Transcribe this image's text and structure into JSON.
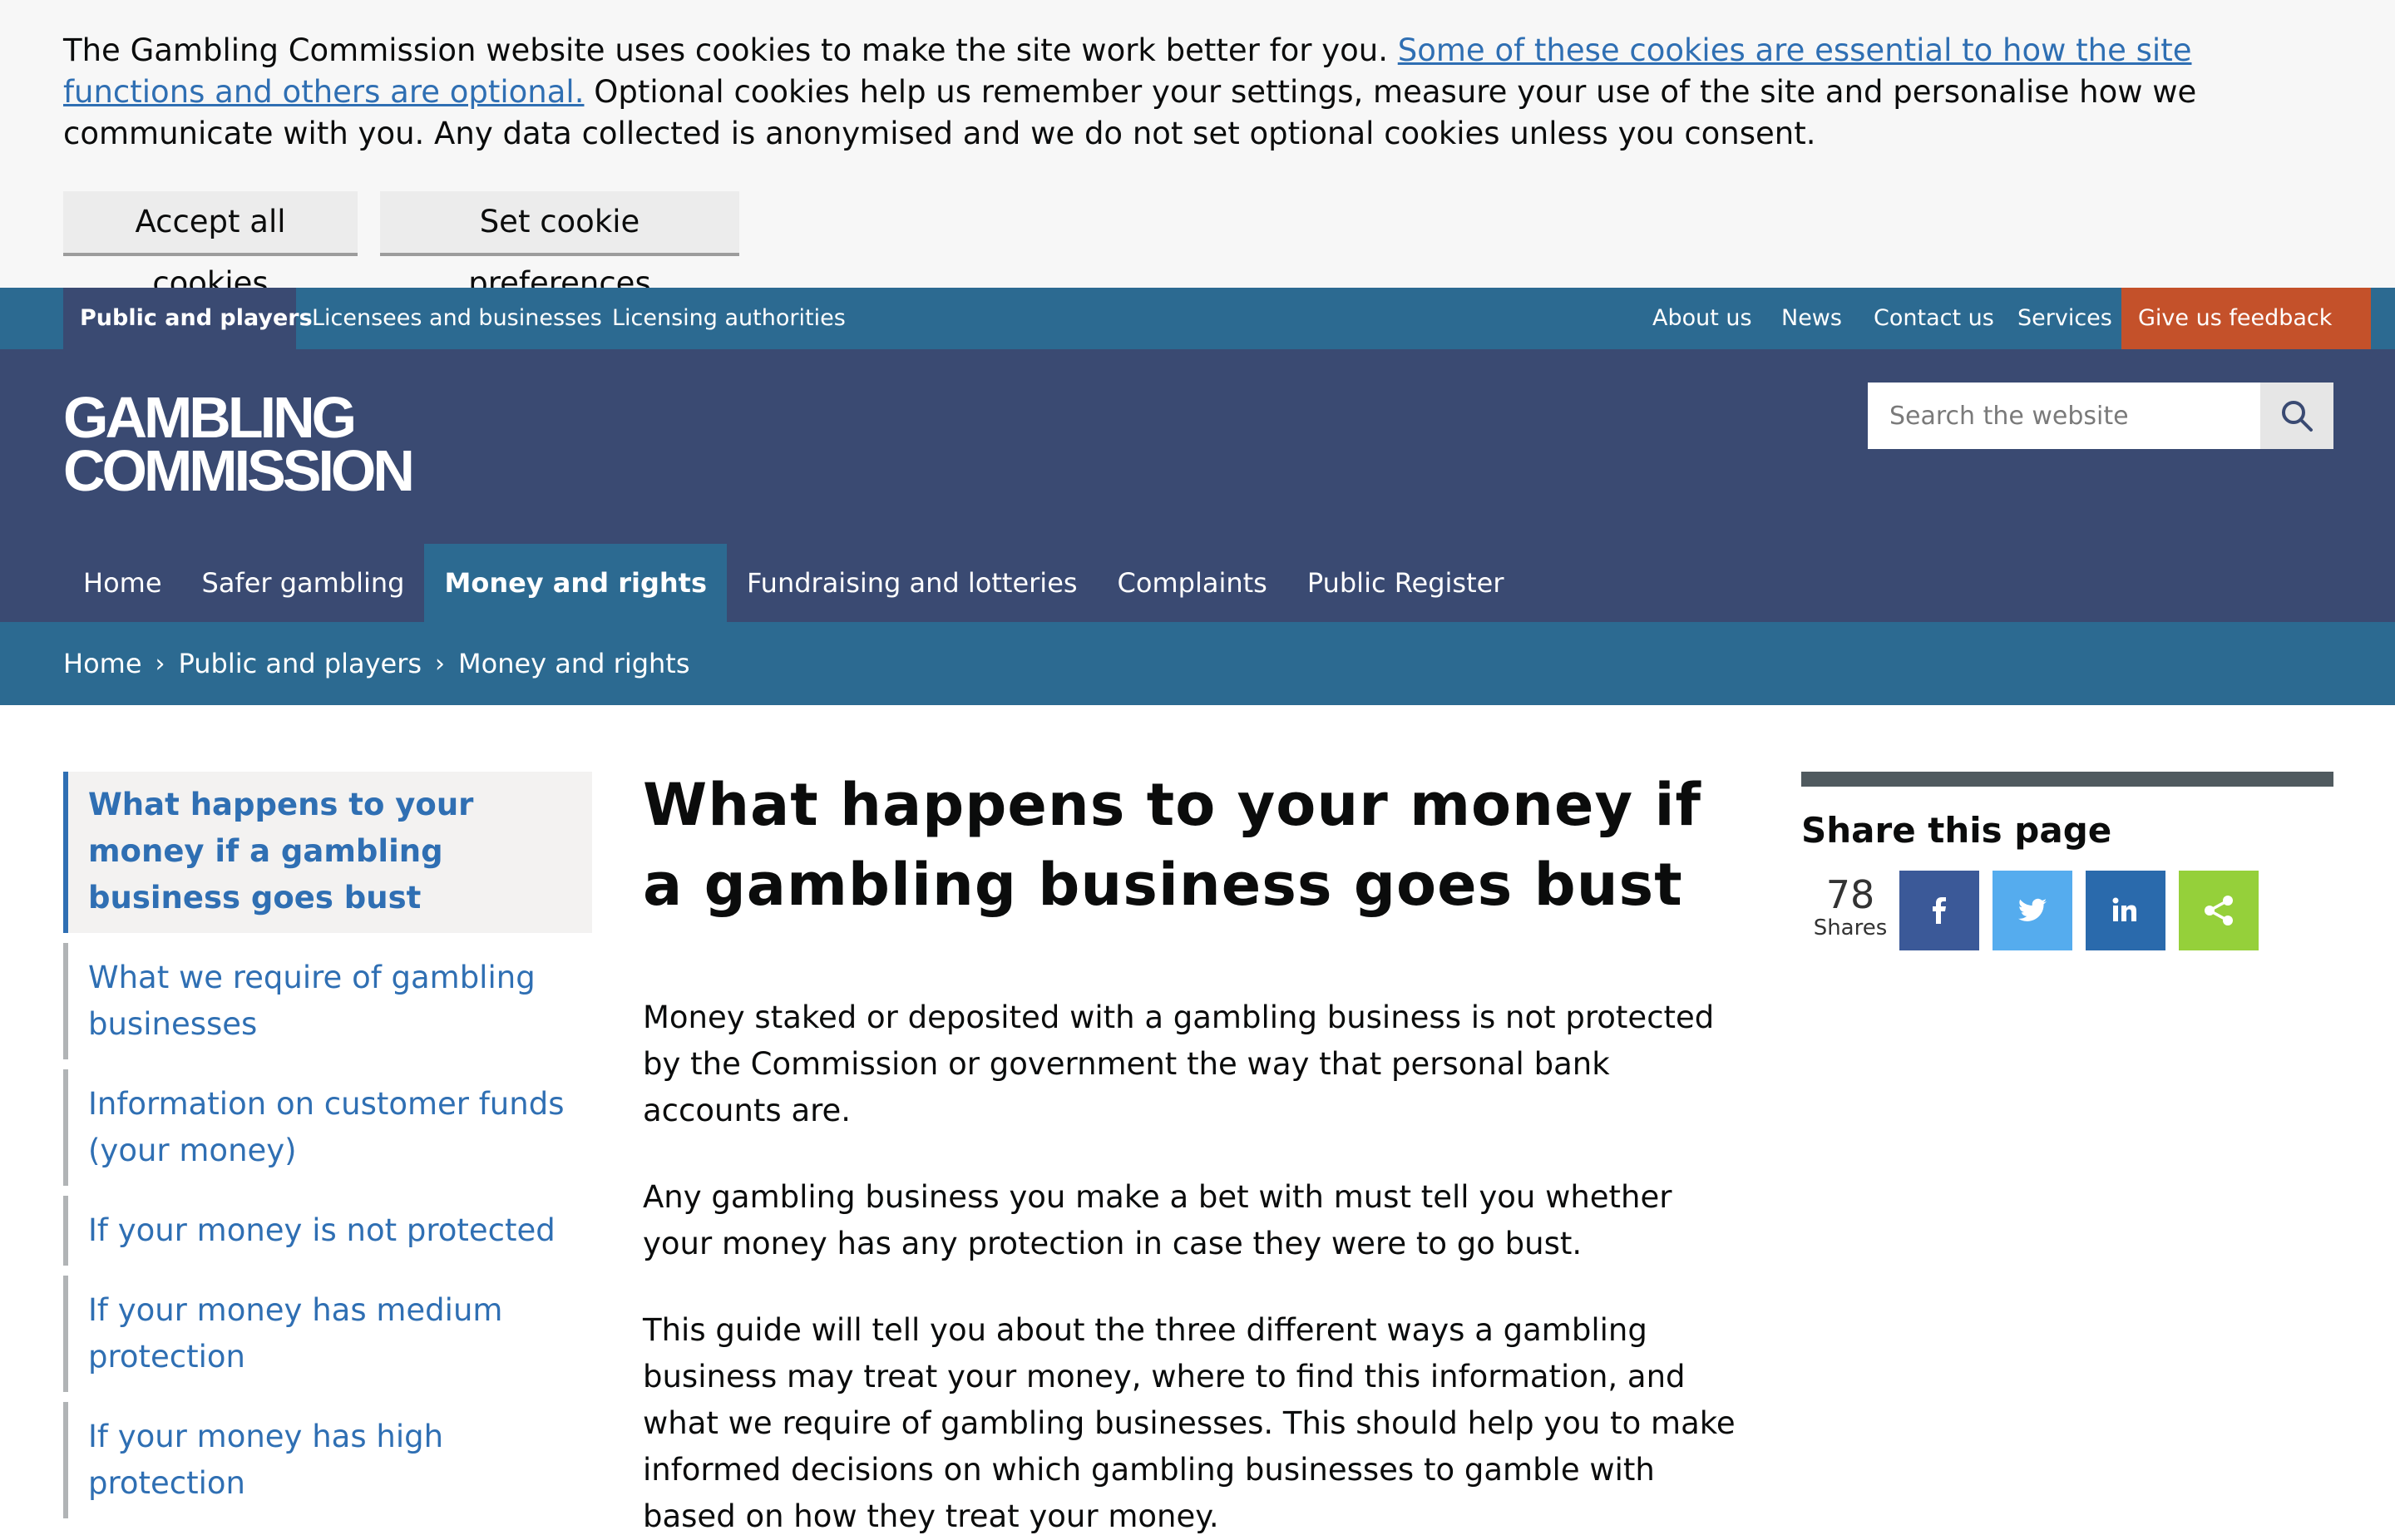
{
  "cookie_banner": {
    "text_before": "The Gambling Commission website uses cookies to make the site work better for you. ",
    "link_text": "Some of these cookies are essential to how the site functions and others are optional.",
    "text_after": " Optional cookies help us remember your settings, measure your use of the site and personalise how we communicate with you. Any data collected is anonymised and we do not set optional cookies unless you consent.",
    "accept_label": "Accept all cookies",
    "prefs_label": "Set cookie preferences"
  },
  "top_bar": {
    "audiences": [
      "Public and players",
      "Licensees and businesses",
      "Licensing authorities"
    ],
    "utility": [
      "About us",
      "News",
      "Contact us",
      "Services"
    ],
    "feedback_label": "Give us feedback"
  },
  "header": {
    "logo_line1": "GAMBLING",
    "logo_line2": "COMMISSION",
    "search_placeholder": "Search the website"
  },
  "main_nav": {
    "items": [
      "Home",
      "Safer gambling",
      "Money and rights",
      "Fundraising and lotteries",
      "Complaints",
      "Public Register"
    ]
  },
  "breadcrumb": {
    "items": [
      "Home",
      "Public and players",
      "Money and rights"
    ]
  },
  "side_nav": {
    "items": [
      "What happens to your money if a gambling business goes bust",
      "What we require of gambling businesses",
      "Information on customer funds (your money)",
      "If your money is not protected",
      "If your money has medium protection",
      "If your money has high protection"
    ]
  },
  "content": {
    "title": "What happens to your money if a gambling business goes bust",
    "paragraphs": [
      "Money staked or deposited with a gambling business is not protected by the Commission or government the way that personal bank accounts are.",
      "Any gambling business you make a bet with must tell you whether your money has any protection in case they were to go bust.",
      "This guide will tell you about the three different ways a gambling business may treat your money, where to find this information, and what we require of gambling businesses. This should help you to make informed decisions on which gambling businesses to gamble with based on how they treat your money."
    ]
  },
  "share": {
    "heading": "Share this page",
    "count": "78",
    "count_label": "Shares",
    "buttons": [
      {
        "icon": "facebook-icon",
        "color": "#3b5998"
      },
      {
        "icon": "twitter-icon",
        "color": "#55acee"
      },
      {
        "icon": "linkedin-icon",
        "color": "#2a6aac"
      },
      {
        "icon": "share-icon",
        "color": "#95d03a"
      }
    ]
  },
  "colors": {
    "top_bar": "#2c6a91",
    "header": "#3a4a72",
    "feedback": "#c4512a",
    "link": "#2f6fb3"
  }
}
